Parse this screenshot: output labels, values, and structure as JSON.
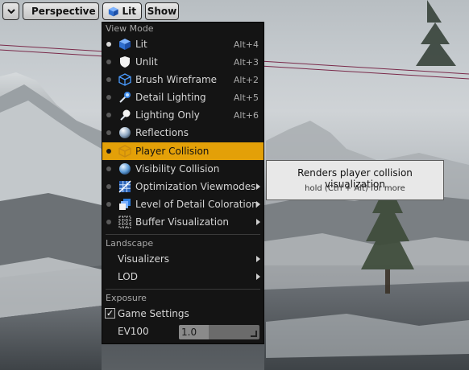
{
  "toolbar": {
    "dropdown_icon": "chevron-down-icon",
    "perspective_label": "Perspective",
    "lit_label": "Lit",
    "show_label": "Show"
  },
  "menu": {
    "view_mode_header": "View Mode",
    "view_modes": [
      {
        "label": "Lit",
        "shortcut": "Alt+4",
        "icon": "lit-cube-icon",
        "selected": true
      },
      {
        "label": "Unlit",
        "shortcut": "Alt+3",
        "icon": "unlit-shield-icon"
      },
      {
        "label": "Brush Wireframe",
        "shortcut": "Alt+2",
        "icon": "wireframe-cube-icon"
      },
      {
        "label": "Detail Lighting",
        "shortcut": "Alt+5",
        "icon": "detail-lighting-icon"
      },
      {
        "label": "Lighting Only",
        "shortcut": "Alt+6",
        "icon": "lighting-only-icon"
      },
      {
        "label": "Reflections",
        "shortcut": "",
        "icon": "reflection-sphere-icon"
      },
      {
        "label": "Player Collision",
        "shortcut": "",
        "icon": "player-collision-icon",
        "highlighted": true
      },
      {
        "label": "Visibility Collision",
        "shortcut": "",
        "icon": "visibility-collision-icon"
      },
      {
        "label": "Optimization Viewmodes",
        "shortcut": "",
        "icon": "optimization-grid-icon",
        "submenu": true
      },
      {
        "label": "Level of Detail Coloration",
        "shortcut": "",
        "icon": "lod-coloration-icon",
        "submenu": true
      },
      {
        "label": "Buffer Visualization",
        "shortcut": "",
        "icon": "buffer-grid-icon",
        "submenu": true
      }
    ],
    "landscape_header": "Landscape",
    "landscape_items": [
      {
        "label": "Visualizers",
        "submenu": true
      },
      {
        "label": "LOD",
        "submenu": true
      }
    ],
    "exposure_header": "Exposure",
    "game_settings_label": "Game Settings",
    "game_settings_checked": true,
    "ev100_label": "EV100",
    "ev100_value": "1.0"
  },
  "tooltip": {
    "title": "Renders player collision visualization",
    "hint": "hold (Ctrl + Alt) for more"
  },
  "colors": {
    "highlight": "#e3a008",
    "menu_bg": "#141414",
    "tooltip_bg": "#e8e8e8",
    "accent_blue": "#2f7fe0"
  }
}
